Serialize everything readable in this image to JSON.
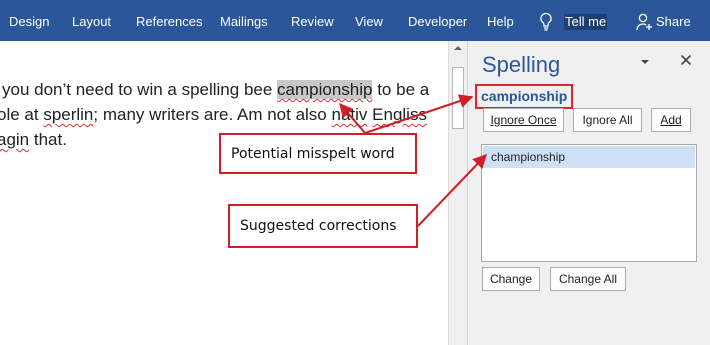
{
  "ribbon": {
    "tabs": [
      "Design",
      "Layout",
      "References",
      "Mailings",
      "Review",
      "View",
      "Developer",
      "Help"
    ],
    "tell_me": "Tell me",
    "share": "Share",
    "color": "#2b579a"
  },
  "document": {
    "line1": {
      "before": "you don’t need to win a spelling bee ",
      "highlighted": "campionship",
      "after": " to be a"
    },
    "line2": {
      "p1": "ole at ",
      "w1": "sperlin",
      "p2": "; many writers are. Am not also ",
      "w2": "nativ",
      "p3": " ",
      "w3": "Engliss"
    },
    "line3": {
      "w1": "agin",
      "p1": " that."
    }
  },
  "spelling_pane": {
    "title": "Spelling",
    "misspelt_word": "campionship",
    "buttons": {
      "ignore_once": "Ignore Once",
      "ignore_all": "Ignore All",
      "add": "Add",
      "change": "Change",
      "change_all": "Change All"
    },
    "suggestions": [
      "championship"
    ]
  },
  "callouts": {
    "misspelt": "Potential misspelt word",
    "suggested": "Suggested corrections"
  },
  "colors": {
    "accent": "#2b579a",
    "callout_border": "#d01f26",
    "selection": "#cde0f5"
  }
}
